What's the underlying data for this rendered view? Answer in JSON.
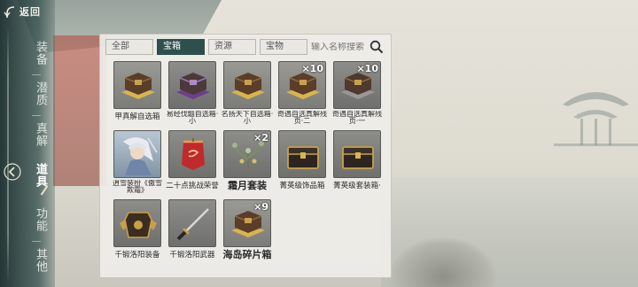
{
  "header": {
    "back_label": "返回"
  },
  "sidebar": {
    "items": [
      {
        "label": "装备",
        "active": false
      },
      {
        "label": "潜质",
        "active": false
      },
      {
        "label": "真解",
        "active": false
      },
      {
        "label": "道具",
        "active": true
      },
      {
        "label": "功能",
        "active": false
      },
      {
        "label": "其他",
        "active": false
      }
    ]
  },
  "tabs": [
    {
      "label": "全部",
      "active": false
    },
    {
      "label": "宝箱",
      "active": true
    },
    {
      "label": "资源",
      "active": false
    },
    {
      "label": "宝物",
      "active": false
    }
  ],
  "search": {
    "placeholder": "输入名称搜索"
  },
  "items": [
    {
      "name": "甲真解自选箱",
      "count": "",
      "icon": "gift-box-icon"
    },
    {
      "name": "易经伐髓自选箱·小",
      "count": "",
      "icon": "purple-gift-box-icon"
    },
    {
      "name": "名扬天下自选箱·小",
      "count": "",
      "icon": "gift-box-icon"
    },
    {
      "name": "奇遇自选真解残页·二",
      "count": "×10",
      "icon": "gift-box-icon"
    },
    {
      "name": "奇遇自选真解残页·一",
      "count": "×10",
      "icon": "gift-box-icon"
    },
    {
      "name": "逍雪装扮《傲雪欺霜》",
      "count": "",
      "icon": "character-portrait-icon"
    },
    {
      "name": "二十点挑战荣誉",
      "count": "",
      "icon": "red-banner-icon"
    },
    {
      "name": "霜月套装",
      "count": "×2",
      "icon": "herb-icon"
    },
    {
      "name": "菁英级饰品箱",
      "count": "",
      "icon": "treasure-chest-icon"
    },
    {
      "name": "菁英级套装箱·一",
      "count": "",
      "icon": "treasure-chest-icon"
    },
    {
      "name": "千锻洛阳装备",
      "count": "",
      "icon": "armor-icon"
    },
    {
      "name": "千锻洛阳武器",
      "count": "",
      "icon": "sword-icon"
    },
    {
      "name": "海岛碎片箱",
      "count": "×9",
      "icon": "gift-box-icon"
    }
  ]
}
